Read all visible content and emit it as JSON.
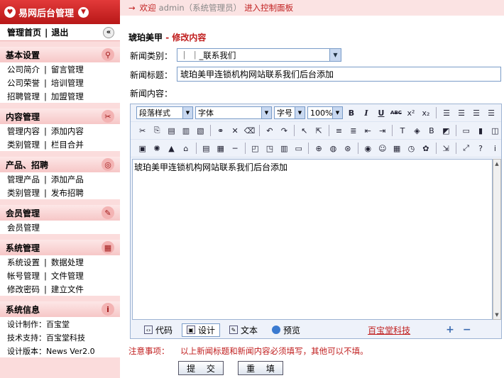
{
  "sidebar": {
    "brand": "易网后台管理",
    "topnav": {
      "home": "管理首页",
      "logout": "退出"
    },
    "groups": [
      {
        "title": "基本设置",
        "icon": "search-icon",
        "rows": [
          [
            "公司简介",
            "留言管理"
          ],
          [
            "公司荣誉",
            "培训管理"
          ],
          [
            "招聘管理",
            "加盟管理"
          ]
        ]
      },
      {
        "title": "内容管理",
        "icon": "tools-icon",
        "rows": [
          [
            "管理内容",
            "添加内容"
          ],
          [
            "类别管理",
            "栏目合并"
          ]
        ]
      },
      {
        "title": "产品、招聘",
        "icon": "target-icon",
        "rows": [
          [
            "管理产品",
            "添加产品"
          ],
          [
            "类别管理",
            "发布招聘"
          ]
        ]
      },
      {
        "title": "会员管理",
        "icon": "brush-icon",
        "rows": [
          [
            "会员管理"
          ]
        ]
      },
      {
        "title": "系统管理",
        "icon": "calendar-icon",
        "rows": [
          [
            "系统设置",
            "数据处理"
          ],
          [
            "帐号管理",
            "文件管理"
          ],
          [
            "修改密码",
            "建立文件"
          ]
        ]
      },
      {
        "title": "系统信息",
        "icon": "info-icon",
        "rows": [
          [
            "设计制作：百宝堂"
          ],
          [
            "技术支持：百宝堂科技"
          ],
          [
            "设计版本：News Ver2.0"
          ]
        ]
      }
    ]
  },
  "header": {
    "arrow": "→",
    "welcome": "欢迎",
    "user": "admin（系统管理员）",
    "suffix": "进入控制面板"
  },
  "page": {
    "site": "琥珀美甲",
    "dash": "-",
    "action": "修改内容"
  },
  "form": {
    "category_label": "新闻类别：",
    "category_value": "｜ ｜_联系我们",
    "title_label": "新闻标题：",
    "title_value": "琥珀美甲连锁机构网站联系我们后台添加",
    "content_label": "新闻内容："
  },
  "editor": {
    "paragraph_style": "段落样式",
    "font": "字体",
    "font_size": "字号",
    "zoom": "100%",
    "content": "琥珀美甲连锁机构网站联系我们后台添加",
    "modes": {
      "code": "代码",
      "design": "设计",
      "text": "文本",
      "preview": "预览"
    },
    "brand_link": "百宝堂科技"
  },
  "notice": {
    "label": "注意事项：",
    "text": "以上新闻标题和新闻内容必须填写，其他可以不填。"
  },
  "buttons": {
    "submit": "提 交",
    "reset": "重 填"
  }
}
